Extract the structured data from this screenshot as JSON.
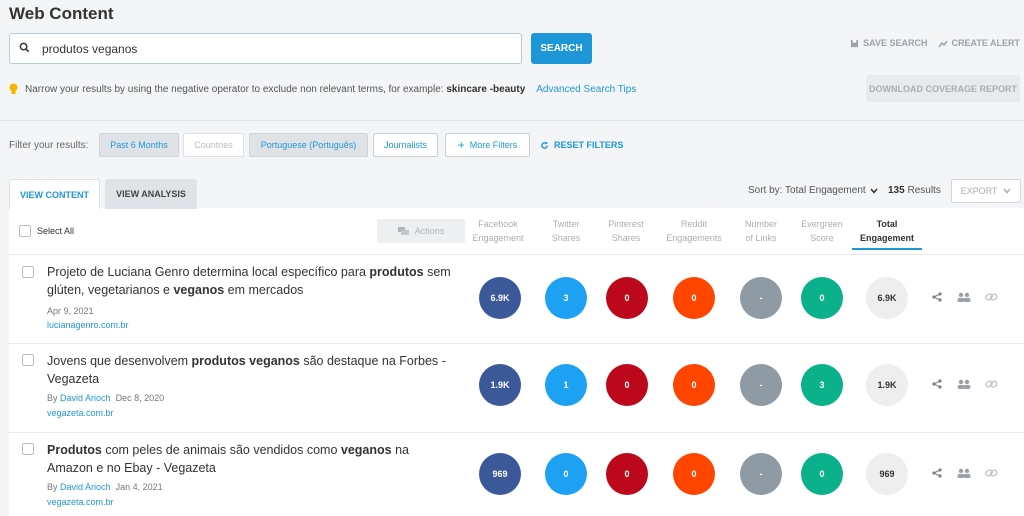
{
  "page_title": "Web Content",
  "search": {
    "value": "produtos veganos",
    "button": "SEARCH"
  },
  "top_actions": {
    "save": "SAVE SEARCH",
    "alert": "CREATE ALERT"
  },
  "tip": {
    "text": "Narrow your results by using the negative operator to exclude non relevant terms, for example:",
    "example": "skincare -beauty",
    "link": "Advanced Search Tips"
  },
  "download_button": "DOWNLOAD COVERAGE REPORT",
  "filters": {
    "label": "Filter your results:",
    "chips": [
      "Past 6 Months",
      "Countries",
      "Portuguese (Português)",
      "Journalists",
      "More Filters"
    ],
    "reset": "RESET FILTERS"
  },
  "tabs": {
    "view_content": "VIEW CONTENT",
    "view_analysis": "VIEW ANALYSIS"
  },
  "sort": {
    "label": "Sort by: Total Engagement",
    "results_count": "135",
    "results_label": "Results",
    "export": "EXPORT"
  },
  "table": {
    "select_all": "Select All",
    "actions": "Actions",
    "columns": [
      {
        "line1": "Facebook",
        "line2": "Engagement"
      },
      {
        "line1": "Twitter",
        "line2": "Shares"
      },
      {
        "line1": "Pinterest",
        "line2": "Shares"
      },
      {
        "line1": "Reddit",
        "line2": "Engagements"
      },
      {
        "line1": "Number",
        "line2": "of Links"
      },
      {
        "line1": "Evergreen",
        "line2": "Score"
      },
      {
        "line1": "Total",
        "line2": "Engagement"
      }
    ],
    "colors": {
      "facebook": "#3b5998",
      "twitter": "#1da1f2",
      "pinterest": "#bd081c",
      "reddit": "#ff4500",
      "links": "#8e9ba5",
      "evergreen": "#0bb18b",
      "total": "#eeeeee",
      "accent": "#1e97d8"
    },
    "rows": [
      {
        "title_parts": [
          "Projeto de Luciana Genro determina local específico para ",
          "produtos",
          " sem glúten, vegetarianos e ",
          "veganos",
          " em mercados"
        ],
        "by": "",
        "author": "",
        "date": "Apr 9, 2021",
        "domain": "lucianagenro.com.br",
        "metrics": [
          "6.9K",
          "3",
          "0",
          "0",
          "-",
          "0",
          "6.9K"
        ]
      },
      {
        "title_parts": [
          "Jovens que desenvolvem ",
          "produtos veganos",
          " são destaque na Forbes - Vegazeta",
          "",
          ""
        ],
        "by": "By",
        "author": "David Arioch",
        "date": "Dec 8, 2020",
        "domain": "vegazeta.com.br",
        "metrics": [
          "1.9K",
          "1",
          "0",
          "0",
          "-",
          "3",
          "1.9K"
        ]
      },
      {
        "title_parts": [
          "",
          "Produtos",
          " com peles de animais são vendidos como ",
          "veganos",
          " na Amazon e no Ebay - Vegazeta"
        ],
        "by": "By",
        "author": "David Arioch",
        "date": "Jan 4, 2021",
        "domain": "vegazeta.com.br",
        "metrics": [
          "969",
          "0",
          "0",
          "0",
          "-",
          "0",
          "969"
        ]
      }
    ]
  }
}
